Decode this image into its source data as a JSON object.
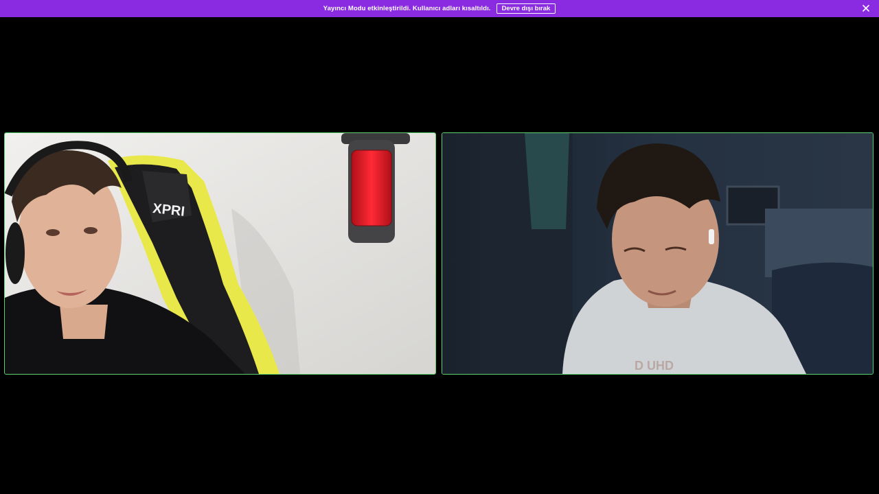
{
  "banner": {
    "message": "Yayıncı Modu etkinleştirildi. Kullanıcı adları kısaltıldı.",
    "disable_button": "Devre dışı bırak",
    "close_icon": "close-icon",
    "background_color": "#8a2be2"
  },
  "call": {
    "speaking_border_color": "#5fd36f",
    "participants": [
      {
        "tile": "left",
        "speaking": true,
        "chair_text": "XPRI"
      },
      {
        "tile": "right",
        "speaking": true,
        "shirt_text": "D UHD"
      }
    ]
  }
}
